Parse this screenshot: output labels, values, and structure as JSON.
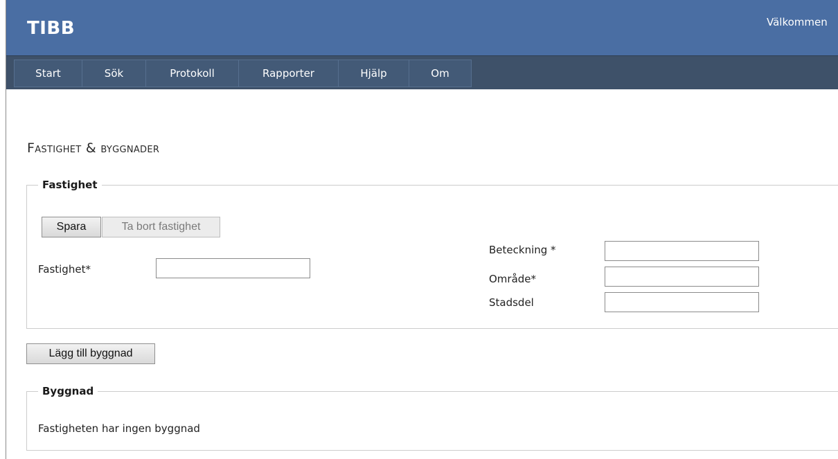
{
  "header": {
    "app_title": "TIBB",
    "welcome_text": "Välkommen"
  },
  "nav": {
    "items": [
      {
        "label": "Start"
      },
      {
        "label": "Sök"
      },
      {
        "label": "Protokoll"
      },
      {
        "label": "Rapporter"
      },
      {
        "label": "Hjälp"
      },
      {
        "label": "Om"
      }
    ]
  },
  "main": {
    "page_title": "Fastighet & byggnader",
    "fastighet_section": {
      "legend": "Fastighet",
      "save_button": "Spara",
      "delete_button": "Ta bort fastighet",
      "fastighet_label": "Fastighet*",
      "fastighet_value": "",
      "beteckning_label": "Beteckning *",
      "beteckning_value": "",
      "omrade_label": "Område*",
      "omrade_value": "",
      "stadsdel_label": "Stadsdel",
      "stadsdel_value": ""
    },
    "add_building_button": "Lägg till byggnad",
    "byggnad_section": {
      "legend": "Byggnad",
      "empty_text": "Fastigheten har ingen byggnad"
    }
  }
}
